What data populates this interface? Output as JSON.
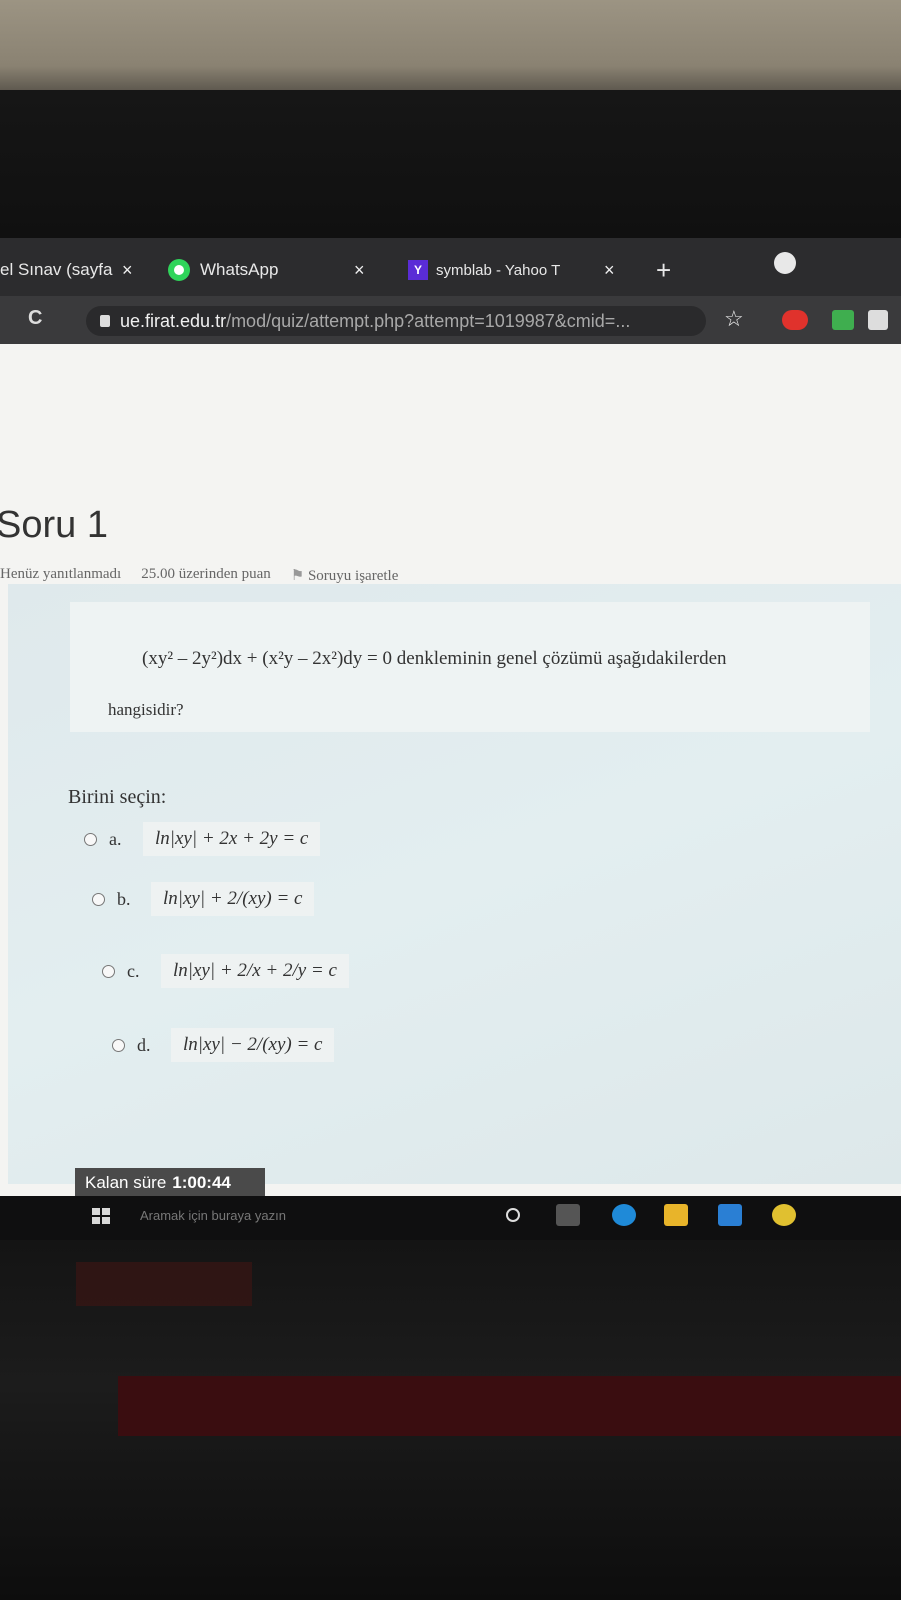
{
  "browser": {
    "tabs": [
      {
        "label": "el Sınav (sayfa",
        "close": "×"
      },
      {
        "label": "WhatsApp",
        "close": "×"
      },
      {
        "label": "symblab - Yahoo T",
        "close": "×"
      }
    ],
    "new_tab": "+",
    "address": {
      "host": "ue.firat.edu.tr",
      "path": "/mod/quiz/attempt.php?attempt=1019987&cmid=..."
    },
    "reload": "C",
    "star": "☆"
  },
  "quiz": {
    "title": "Soru 1",
    "status": "Henüz yanıtlanmadı",
    "points": "25.00 üzerinden puan",
    "flag": "Soruyu işaretle",
    "question_line1": "(xy² – 2y²)dx + (x²y – 2x²)dy = 0  denkleminin genel çözümü aşağıdakilerden",
    "question_line2": "hangisidir?",
    "prompt": "Birini seçin:",
    "options": [
      {
        "letter": "a.",
        "formula": "ln|xy| + 2x + 2y = c"
      },
      {
        "letter": "b.",
        "formula": "ln|xy| + 2/(xy) = c"
      },
      {
        "letter": "c.",
        "formula": "ln|xy| + 2/x + 2/y = c"
      },
      {
        "letter": "d.",
        "formula": "ln|xy| − 2/(xy) = c"
      }
    ],
    "timer_label": "Kalan süre",
    "timer_value": "1:00:44"
  },
  "taskbar": {
    "search": "Aramak için buraya yazın"
  },
  "colors": {
    "tab_bar": "#2c2c2e",
    "address_bar": "#3a3a3c",
    "whatsapp": "#2fd45a",
    "yahoo": "#5a2cd6"
  }
}
